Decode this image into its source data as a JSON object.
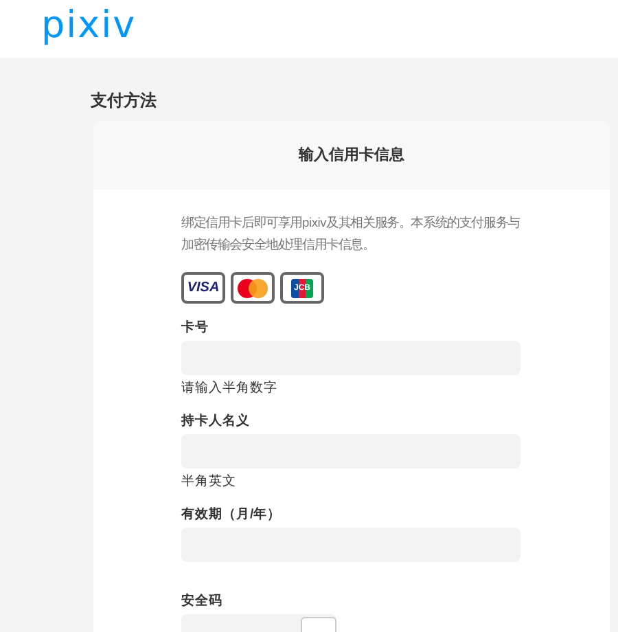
{
  "logo": "pixiv",
  "page_title": "支付方法",
  "card": {
    "title": "输入信用卡信息",
    "description": "绑定信用卡后即可享用pixiv及其相关服务。本系统的支付服务与加密传输会安全地处理信用卡信息。",
    "brands": [
      {
        "kind": "visa",
        "text": "VISA"
      },
      {
        "kind": "mastercard"
      },
      {
        "kind": "jcb",
        "text": "JCB"
      }
    ],
    "fields": [
      {
        "label": "卡号",
        "hint": "请输入半角数字"
      },
      {
        "label": "持卡人名义",
        "hint": "半角英文"
      },
      {
        "label": "有效期（月/年）"
      },
      {
        "label": "安全码",
        "kind": "short"
      }
    ]
  }
}
